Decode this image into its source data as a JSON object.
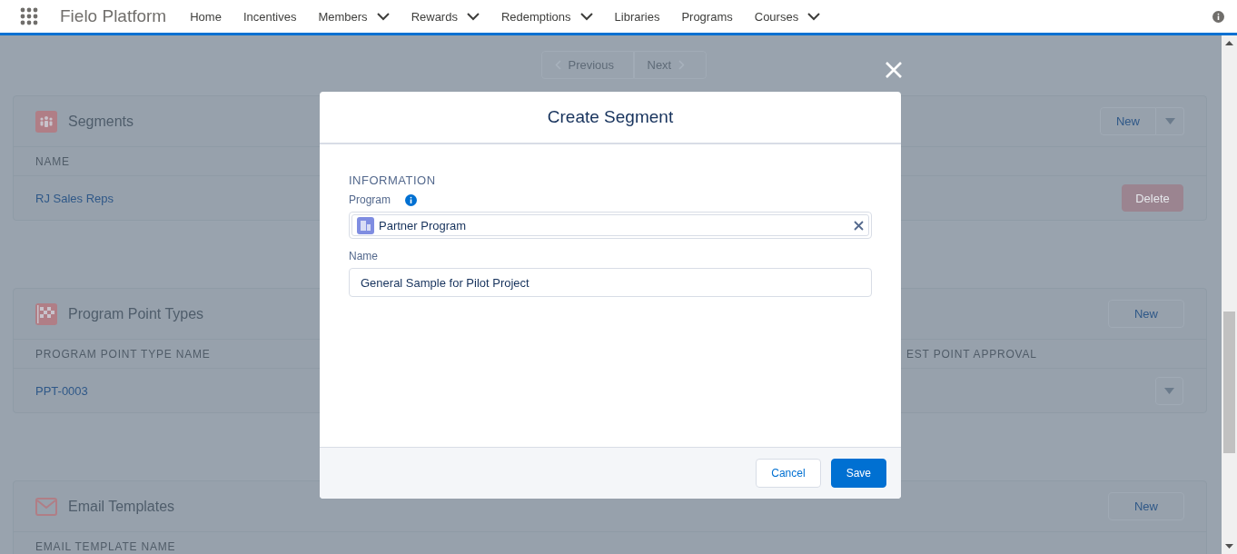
{
  "nav": {
    "app_name": "Fielo Platform",
    "items": [
      {
        "label": "Home",
        "has_menu": false
      },
      {
        "label": "Incentives",
        "has_menu": false
      },
      {
        "label": "Members",
        "has_menu": true
      },
      {
        "label": "Rewards",
        "has_menu": true
      },
      {
        "label": "Redemptions",
        "has_menu": true
      },
      {
        "label": "Libraries",
        "has_menu": false
      },
      {
        "label": "Programs",
        "has_menu": false
      },
      {
        "label": "Courses",
        "has_menu": true
      }
    ]
  },
  "pager": {
    "previous": "Previous",
    "next": "Next"
  },
  "cards": [
    {
      "title": "Segments",
      "new_button": "New",
      "new_menu": true,
      "columns": [
        "NAME"
      ],
      "rows": [
        {
          "cells": [
            "RJ Sales Reps"
          ],
          "action": {
            "kind": "delete",
            "label": "Delete"
          }
        }
      ]
    },
    {
      "title": "Program Point Types",
      "new_button": "New",
      "new_menu": false,
      "columns": [
        "PROGRAM POINT TYPE NAME",
        "EST POINT APPROVAL"
      ],
      "rows": [
        {
          "cells": [
            "PPT-0003"
          ],
          "action": {
            "kind": "menu"
          }
        }
      ]
    },
    {
      "title": "Email Templates",
      "new_button": "New",
      "new_menu": false,
      "columns": [
        "EMAIL TEMPLATE NAME"
      ]
    }
  ],
  "modal": {
    "title": "Create Segment",
    "section": "INFORMATION",
    "program": {
      "label": "Program",
      "value": "Partner Program"
    },
    "name": {
      "label": "Name",
      "value": "General Sample for Pilot Project"
    },
    "cancel": "Cancel",
    "save": "Save"
  }
}
